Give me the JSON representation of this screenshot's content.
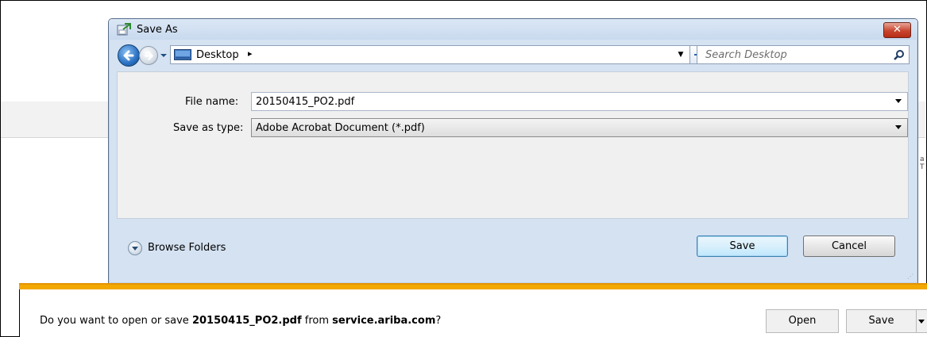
{
  "dialog": {
    "title": "Save As",
    "close_label": "✕",
    "address": {
      "location": "Desktop",
      "separator": "▸"
    },
    "search": {
      "placeholder": "Search Desktop"
    },
    "file_name": {
      "label": "File name:",
      "value": "20150415_PO2.pdf"
    },
    "save_as_type": {
      "label": "Save as type:",
      "value": "Adobe Acrobat Document (*.pdf)"
    },
    "browse_folders": "Browse Folders",
    "buttons": {
      "save": "Save",
      "cancel": "Cancel"
    }
  },
  "notification": {
    "prefix": "Do you want to open or save ",
    "filename": "20150415_PO2.pdf",
    "middle": " from ",
    "site": "service.ariba.com",
    "suffix": "?",
    "open_label": "Open",
    "save_label": "Save"
  },
  "colors": {
    "notification_accent": "#f3a800",
    "dialog_frame": "#d4e2f2",
    "close_button": "#c8452e"
  }
}
